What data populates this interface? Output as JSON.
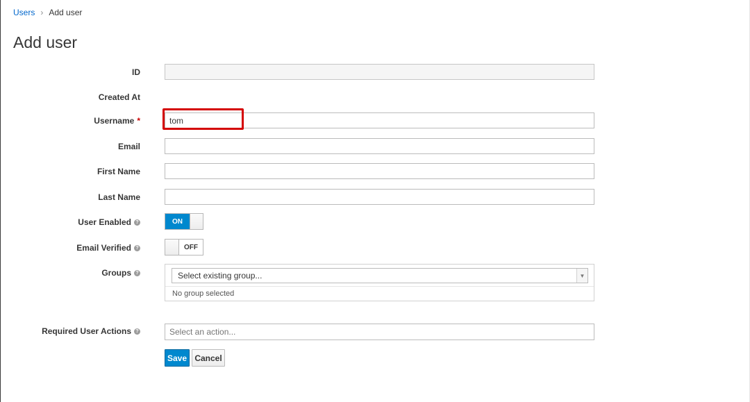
{
  "breadcrumb": {
    "parent": "Users",
    "separator": "›",
    "current": "Add user"
  },
  "page_title": "Add user",
  "form": {
    "id_label": "ID",
    "id_value": "",
    "created_at_label": "Created At",
    "username_label": "Username",
    "username_required": "*",
    "username_value": "tom",
    "email_label": "Email",
    "email_value": "",
    "first_name_label": "First Name",
    "first_name_value": "",
    "last_name_label": "Last Name",
    "last_name_value": "",
    "user_enabled_label": "User Enabled",
    "user_enabled_state": "ON",
    "email_verified_label": "Email Verified",
    "email_verified_state": "OFF",
    "groups_label": "Groups",
    "groups_placeholder": "Select existing group...",
    "groups_empty": "No group selected",
    "required_actions_label": "Required User Actions",
    "required_actions_placeholder": "Select an action..."
  },
  "buttons": {
    "save": "Save",
    "cancel": "Cancel"
  },
  "colors": {
    "primary": "#0088ce",
    "link": "#0066cc",
    "highlight": "#d40000",
    "required": "#cc0000"
  },
  "icons": {
    "help": "question-circle-icon",
    "breadcrumb_separator": "chevron-right-icon",
    "dropdown": "caret-down-icon"
  }
}
